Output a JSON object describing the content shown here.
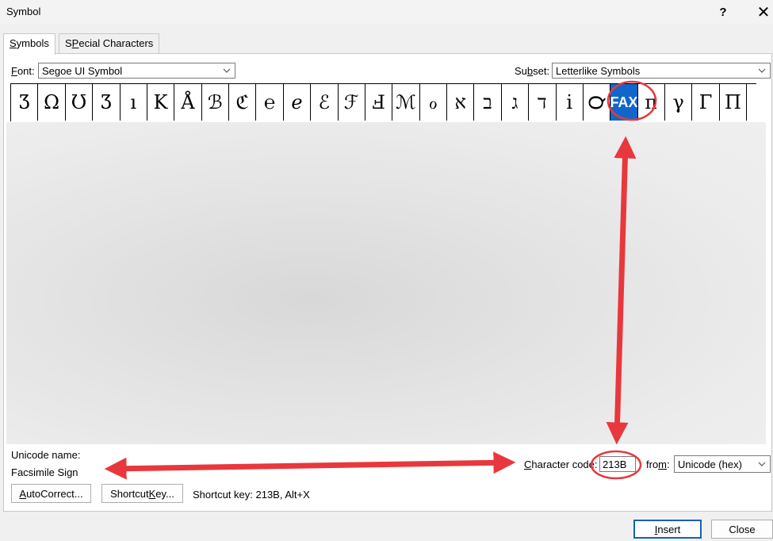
{
  "window": {
    "title": "Symbol",
    "help_label": "?",
    "close_label": "✕"
  },
  "tabs": [
    {
      "label": "Symbols",
      "underline": "S",
      "rest": "ymbols",
      "active": true
    },
    {
      "label": "Special Characters",
      "underline": "P",
      "pre": "S",
      "rest": "ecial Characters",
      "active": false
    }
  ],
  "font": {
    "label_u": "F",
    "label_rest": "ont:",
    "value": "Segoe UI Symbol"
  },
  "subset": {
    "label_pre": "Su",
    "label_u": "b",
    "label_rest": "set:",
    "value": "Letterlike Symbols"
  },
  "symbols": [
    "Ʒ",
    "Ω",
    "Ʊ",
    "Ʒ",
    "ı",
    "K",
    "Å",
    "ℬ",
    "ℭ",
    "℮",
    "ℯ",
    "ℰ",
    "ℱ",
    "Ⅎ",
    "ℳ",
    "ℴ",
    "א",
    "ב",
    "ג",
    "ד",
    "i",
    "℺",
    "FAX",
    "π",
    "γ",
    "Γ",
    "Π"
  ],
  "selected_symbol": "FAX",
  "unicode": {
    "name_label": "Unicode name:",
    "name_value": "Facsimile Sign"
  },
  "char_code": {
    "label_u": "C",
    "label_rest": "haracter code:",
    "value": "213B"
  },
  "from": {
    "label_pre": "fro",
    "label_u": "m",
    "label_rest": ":",
    "value": "Unicode (hex)"
  },
  "buttons": {
    "autocorrect_u": "A",
    "autocorrect_rest": "utoCorrect...",
    "shortcut_pre": "Shortcut ",
    "shortcut_u": "K",
    "shortcut_rest": "ey...",
    "insert_u": "I",
    "insert_rest": "nsert",
    "close": "Close"
  },
  "shortcut_text": "Shortcut key: 213B, Alt+X",
  "colors": {
    "annotation": "#e8383d",
    "selection": "#1166cc",
    "dialog_bg": "#f0f0f0"
  }
}
